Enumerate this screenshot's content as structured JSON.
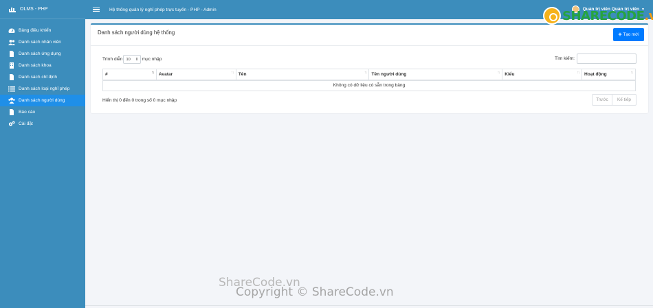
{
  "app": {
    "brand": "OLMS - PHP",
    "topbar_title": "Hệ thống quản lý nghỉ phép trực tuyến - PHP - Admin"
  },
  "user": {
    "name": "Quản trị viên Quản trị viên"
  },
  "sidebar": {
    "items": [
      {
        "label": "Bảng điều khiển",
        "icon": "dashboard-icon"
      },
      {
        "label": "Danh sách nhân viên",
        "icon": "users-icon"
      },
      {
        "label": "Danh sách ứng dụng",
        "icon": "file-icon"
      },
      {
        "label": "Danh sách khoa",
        "icon": "building-icon"
      },
      {
        "label": "Danh sách chỉ định",
        "icon": "file-icon"
      },
      {
        "label": "Danh sách loại nghỉ phép",
        "icon": "list-icon"
      },
      {
        "label": "Danh sách người dùng",
        "icon": "users-icon",
        "active": true
      },
      {
        "label": "Báo cáo",
        "icon": "file-icon"
      },
      {
        "label": "Cài đặt",
        "icon": "gears-icon"
      }
    ]
  },
  "card": {
    "title": "Danh sách người dùng hệ thống",
    "create_label": "Tạo mới",
    "length_prefix": "Trình diễn",
    "length_value": "10",
    "length_suffix": "mục nhập",
    "search_label": "Tìm kiếm:",
    "search_value": "",
    "columns": [
      "#",
      "Avatar",
      "Tên",
      "Tên người dùng",
      "Kiểu",
      "Hoạt động"
    ],
    "empty_message": "Không có dữ liệu có sẵn trong bảng",
    "info": "Hiển thị 0 đến 0 trong số 0 mục nhập",
    "prev_label": "Trước",
    "next_label": "Kế tiếp"
  },
  "watermarks": {
    "logo_part1": "SHARECODE",
    "logo_part2": ".vn",
    "center": "ShareCode.vn",
    "copyright": "Copyright © ShareCode.vn"
  },
  "colors": {
    "sidebar": "#3c8dbc",
    "active_item": "#1f8fe8",
    "primary_button": "#007bff"
  }
}
